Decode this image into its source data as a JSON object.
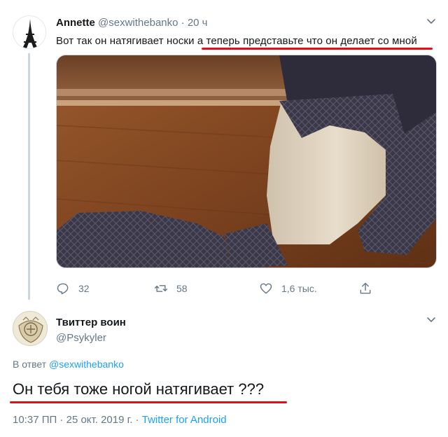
{
  "tweet": {
    "author_name": "Annette",
    "author_handle": "@sexwithebanko",
    "separator": "·",
    "time": "20 ч",
    "text_plain": "Вот так он натягивает носки ",
    "text_highlight": "а теперь представьте что он делает со мной",
    "media": "photo",
    "stats": {
      "replies": "32",
      "retweets": "58",
      "likes": "1,6 тыс."
    }
  },
  "reply": {
    "author_name": "Твиттер воин",
    "author_handle": "@Psykyler",
    "reply_prefix": "В ответ",
    "reply_mention": "@sexwithebanko",
    "text": "Он тебя тоже ногой натягивает ???",
    "timestamp": "10:37 ПП · 25 окт. 2019 г. · ",
    "source": "Twitter for Android"
  },
  "colors": {
    "accent_blue": "#1da1f2",
    "muted_gray": "#657786",
    "underline_red": "#e0101a"
  },
  "icons": [
    "reply-icon",
    "retweet-icon",
    "like-icon",
    "share-icon",
    "chevron-down-icon"
  ]
}
